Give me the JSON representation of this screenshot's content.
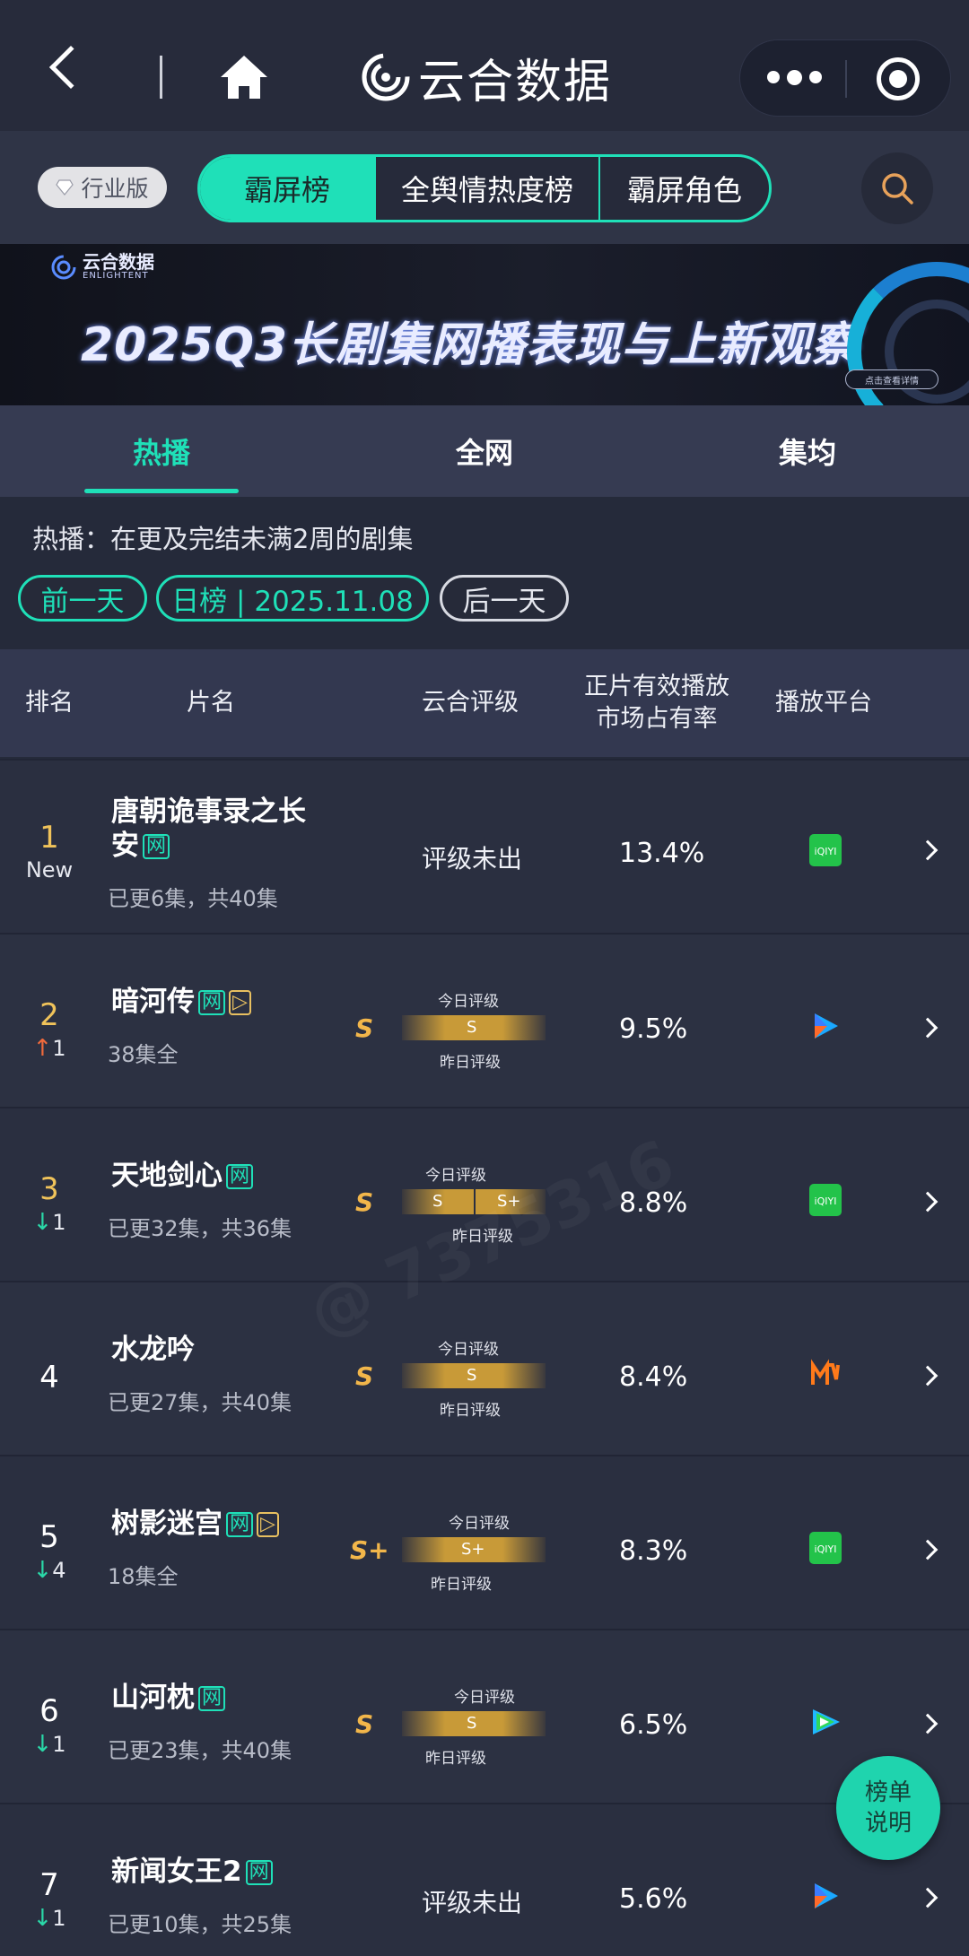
{
  "app": {
    "brand": "云合数据"
  },
  "filters": {
    "edition": "行业版",
    "segments": [
      "霸屏榜",
      "全舆情热度榜",
      "霸屏角色"
    ]
  },
  "banner": {
    "logo_cn": "云合数据",
    "logo_en": "ENLIGHTENT",
    "title": "2025Q3长剧集网播表现与上新观察",
    "more": "点击查看详情"
  },
  "tabs": [
    "热播",
    "全网",
    "集均"
  ],
  "note": "热播：在更及完结未满2周的剧集",
  "date_nav": {
    "prev": "前一天",
    "current": "日榜 | 2025.11.08",
    "next": "后一天"
  },
  "table": {
    "headers": {
      "rank": "排名",
      "name": "片名",
      "rating": "云合评级",
      "share_line1": "正片有效播放",
      "share_line2": "市场占有率",
      "platform": "播放平台"
    },
    "rating_labels": {
      "today": "今日评级",
      "yesterday": "昨日评级"
    },
    "rows": [
      {
        "rank": "1",
        "trend": "New",
        "title_l1": "唐朝诡事录之长",
        "title_l2": "安",
        "tags": [
          "网"
        ],
        "sub": "已更6集，共40集",
        "rating": "评级未出",
        "share": "13.4%",
        "platform": "iqiyi"
      },
      {
        "rank": "2",
        "trend": "↑1",
        "title": "暗河传",
        "tags": [
          "网",
          "▷"
        ],
        "sub": "38集全",
        "grade": "S",
        "today": "S",
        "share": "9.5%",
        "platform": "youku"
      },
      {
        "rank": "3",
        "trend": "↓1",
        "title": "天地剑心",
        "tags": [
          "网"
        ],
        "sub": "已更32集，共36集",
        "grade": "S",
        "today": "S",
        "yesterday": "S+",
        "share": "8.8%",
        "platform": "iqiyi"
      },
      {
        "rank": "4",
        "trend": "",
        "title": "水龙吟",
        "tags": [],
        "sub": "已更27集，共40集",
        "grade": "S",
        "today": "S",
        "share": "8.4%",
        "platform": "mgtv"
      },
      {
        "rank": "5",
        "trend": "↓4",
        "title": "树影迷宫",
        "tags": [
          "网",
          "▷"
        ],
        "sub": "18集全",
        "grade": "S+",
        "today": "S+",
        "share": "8.3%",
        "platform": "iqiyi"
      },
      {
        "rank": "6",
        "trend": "↓1",
        "title": "山河枕",
        "tags": [
          "网"
        ],
        "sub": "已更23集，共40集",
        "grade": "S",
        "today": "S",
        "share": "6.5%",
        "platform": "tencent"
      },
      {
        "rank": "7",
        "trend": "↓1",
        "title": "新闻女王2",
        "tags": [
          "网"
        ],
        "sub": "已更10集，共25集",
        "rating": "评级未出",
        "share": "5.6%",
        "platform": "youku"
      }
    ]
  },
  "float_button": {
    "line1": "榜单",
    "line2": "说明"
  },
  "watermark": "@ 7375316",
  "colors": {
    "accent": "#1fe0b8",
    "gold": "#f0c35a",
    "up": "#f06a3c",
    "down": "#2ad8a8"
  }
}
